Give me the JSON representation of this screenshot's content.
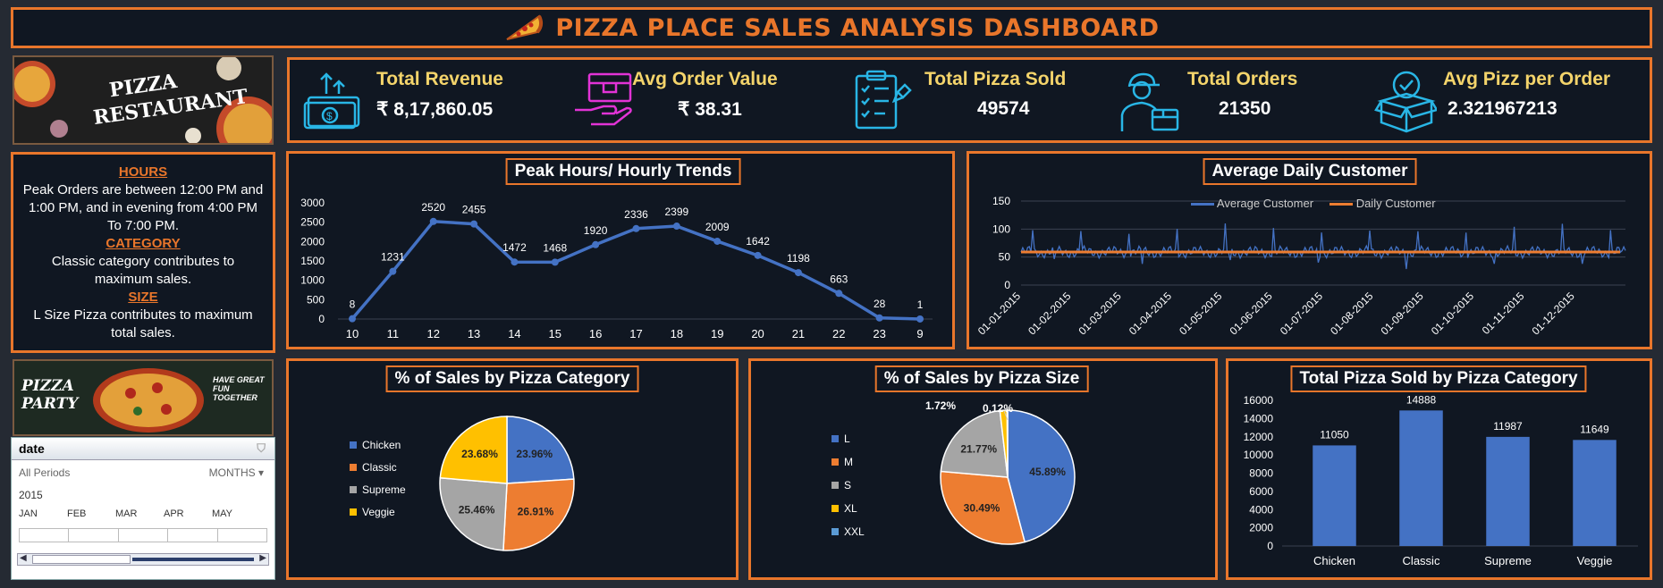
{
  "title": "PIZZA PLACE SALES ANALYSIS DASHBOARD",
  "images": {
    "top": "PIZZA RESTAURANT",
    "bottom_main": "PIZZA PARTY",
    "bottom_tag": "HAVE GREAT FUN TOGETHER"
  },
  "kpis": [
    {
      "label": "Total Revenue",
      "value": "₹ 8,17,860.05",
      "icon": "money-transfer-icon",
      "color": "#29b6e6"
    },
    {
      "label": "Avg Order Value",
      "value": "₹ 38.31",
      "icon": "hand-delivery-box-icon",
      "color": "#e233d6"
    },
    {
      "label": "Total Pizza Sold",
      "value": "49574",
      "icon": "checklist-clipboard-icon",
      "color": "#29b6e6"
    },
    {
      "label": "Total Orders",
      "value": "21350",
      "icon": "delivery-person-icon",
      "color": "#29b6e6"
    },
    {
      "label": "Avg Pizz per Order",
      "value": "2.321967213",
      "icon": "verified-box-icon",
      "color": "#29b6e6"
    }
  ],
  "insights": {
    "h1": "HOURS",
    "t1": "Peak Orders are between 12:00 PM and 1:00 PM, and in evening from 4:00 PM To 7:00 PM.",
    "h2": "CATEGORY",
    "t2": "Classic category contributes to maximum sales.",
    "h3": "SIZE",
    "t3": "L Size Pizza contributes to maximum total sales."
  },
  "slicer": {
    "field": "date",
    "all_periods": "All Periods",
    "level": "MONTHS",
    "year": "2015",
    "months": [
      "JAN",
      "FEB",
      "MAR",
      "APR",
      "MAY"
    ]
  },
  "colors": {
    "accent": "#e9762b",
    "blue": "#4472c4",
    "orange": "#ed7d31",
    "gray": "#a5a5a5",
    "yellow": "#ffc000",
    "lightblue": "#5b9bd5",
    "kpi_label": "#f4d46b"
  },
  "chart_data": [
    {
      "type": "line",
      "title": "Peak Hours/ Hourly Trends",
      "categories": [
        "10",
        "11",
        "12",
        "13",
        "14",
        "15",
        "16",
        "17",
        "18",
        "19",
        "20",
        "21",
        "22",
        "23",
        "9"
      ],
      "values": [
        8,
        1231,
        2520,
        2455,
        1472,
        1468,
        1920,
        2336,
        2399,
        2009,
        1642,
        1198,
        663,
        28,
        1
      ],
      "ylim": [
        0,
        3000
      ],
      "yticks": [
        0,
        500,
        1000,
        1500,
        2000,
        2500,
        3000
      ]
    },
    {
      "type": "line",
      "title": "Average Daily Customer",
      "series": [
        {
          "name": "Average Customer",
          "color": "#4472c4"
        },
        {
          "name": "Daily Customer",
          "color": "#ed7d31"
        }
      ],
      "ylim": [
        0,
        150
      ],
      "yticks": [
        0,
        25,
        50,
        75,
        100,
        125,
        150
      ],
      "x_labels": [
        "01-01-2015",
        "01-02-2015",
        "01-03-2015",
        "01-04-2015",
        "01-05-2015",
        "01-06-2015",
        "01-07-2015",
        "01-08-2015",
        "01-09-2015",
        "01-10-2015",
        "01-11-2015",
        "01-12-2015"
      ],
      "approx_daily_level": 59
    },
    {
      "type": "pie",
      "title": "% of Sales by Pizza Category",
      "labels": [
        "Chicken",
        "Classic",
        "Supreme",
        "Veggie"
      ],
      "values": [
        23.96,
        26.91,
        25.46,
        23.68
      ],
      "value_labels": [
        "23.96%",
        "26.91%",
        "25.46%",
        "23.68%"
      ]
    },
    {
      "type": "pie",
      "title": "% of Sales by Pizza Size",
      "labels": [
        "L",
        "M",
        "S",
        "XL",
        "XXL"
      ],
      "values": [
        45.89,
        30.49,
        21.77,
        1.72,
        0.12
      ],
      "value_labels": [
        "45.89%",
        "30.49%",
        "21.77%",
        "1.72%",
        "0.12%"
      ]
    },
    {
      "type": "bar",
      "title": "Total Pizza Sold by Pizza Category",
      "categories": [
        "Chicken",
        "Classic",
        "Supreme",
        "Veggie"
      ],
      "values": [
        11050,
        14888,
        11987,
        11649
      ],
      "ylim": [
        0,
        16000
      ],
      "yticks": [
        0,
        2000,
        4000,
        6000,
        8000,
        10000,
        12000,
        14000,
        16000
      ]
    }
  ]
}
